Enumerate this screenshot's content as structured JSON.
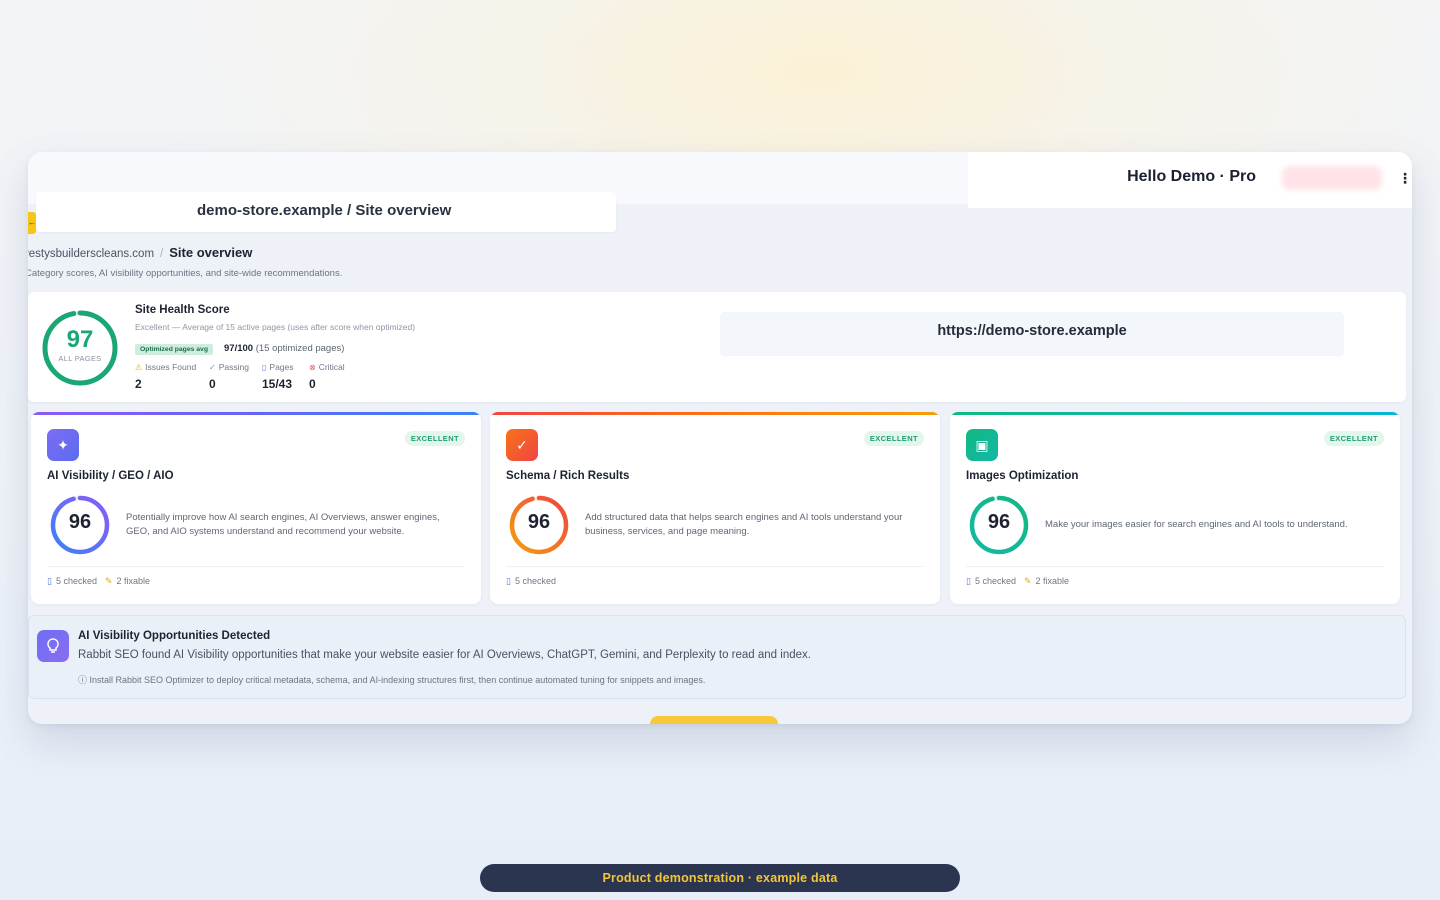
{
  "header": {
    "greeting": "Hello Demo · Pro",
    "page_title": "demo-store.example / Site overview"
  },
  "breadcrumb": {
    "site": "vestysbuilderscleans.com",
    "separator": "/",
    "current": "Site overview"
  },
  "subtitle": "Category scores, AI visibility opportunities, and site-wide recommendations.",
  "health": {
    "score": "97",
    "score_value": 97,
    "score_label": "ALL PAGES",
    "title": "Site Health Score",
    "description": "Excellent — Average of 15 active pages (uses after score when optimized)",
    "chip": "Optimized pages avg",
    "score_text": "97/100",
    "score_note": "(15 optimized pages)",
    "stats": [
      {
        "label": "Issues Found",
        "value": "2",
        "icon": "warning-icon"
      },
      {
        "label": "Passing",
        "value": "0",
        "icon": "check-circle-icon"
      },
      {
        "label": "Pages",
        "value": "15/43",
        "icon": "document-icon"
      },
      {
        "label": "Critical",
        "value": "0",
        "icon": "x-circle-icon"
      }
    ],
    "url": "https://demo-store.example"
  },
  "cards": [
    {
      "title": "AI Visibility / GEO / AIO",
      "badge": "EXCELLENT",
      "score": "96",
      "score_value": 96,
      "description": "Potentially improve how AI search engines, AI Overviews, answer engines, GEO, and AIO systems understand and recommend your website.",
      "checked": "5 checked",
      "fixable": "2 fixable",
      "icon": "sparkles-icon",
      "accent": "#6b6ef0"
    },
    {
      "title": "Schema / Rich Results",
      "badge": "EXCELLENT",
      "score": "96",
      "score_value": 96,
      "description": "Add structured data that helps search engines and AI tools understand your business, services, and page meaning.",
      "checked": "5 checked",
      "fixable": "",
      "icon": "badge-check-icon",
      "accent": "#f0643c"
    },
    {
      "title": "Images Optimization",
      "badge": "EXCELLENT",
      "score": "96",
      "score_value": 96,
      "description": "Make your images easier for search engines and AI tools to understand.",
      "checked": "5 checked",
      "fixable": "2 fixable",
      "icon": "image-icon",
      "accent": "#14b8a6"
    }
  ],
  "opportunities": {
    "title": "AI Visibility Opportunities Detected",
    "text": "Rabbit SEO found AI Visibility opportunities that make your website easier for AI Overviews, ChatGPT, Gemini, and Perplexity to read and index.",
    "note": "Install Rabbit SEO Optimizer to deploy critical metadata, schema, and AI-indexing structures first, then continue automated tuning for snippets and images."
  },
  "demo_banner": "Product demonstration · example data",
  "colors": {
    "success": "#1aa774",
    "brand_yellow": "#f5c518",
    "banner_bg": "#2b3550",
    "banner_text": "#f3c63a"
  }
}
